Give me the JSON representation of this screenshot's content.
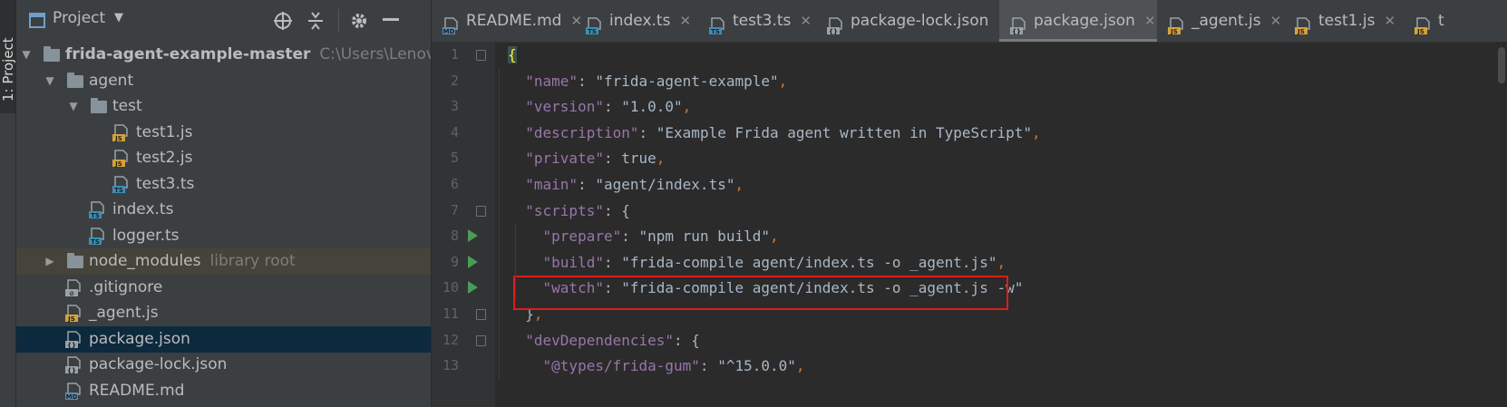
{
  "toolstrip": {
    "project_tab_label": "1: Project"
  },
  "project_panel": {
    "title": "Project",
    "tree": [
      {
        "label": "frida-agent-example-master",
        "hint": "C:\\Users\\Lenovo",
        "type": "folder",
        "expanded": true,
        "bold": true
      },
      {
        "label": "agent",
        "hint": "",
        "type": "folder",
        "expanded": true
      },
      {
        "label": "test",
        "hint": "",
        "type": "folder",
        "expanded": true
      },
      {
        "label": "test1.js",
        "hint": "",
        "type": "js"
      },
      {
        "label": "test2.js",
        "hint": "",
        "type": "js"
      },
      {
        "label": "test3.ts",
        "hint": "",
        "type": "ts"
      },
      {
        "label": "index.ts",
        "hint": "",
        "type": "ts"
      },
      {
        "label": "logger.ts",
        "hint": "",
        "type": "ts"
      },
      {
        "label": "node_modules",
        "hint": "library root",
        "type": "folder",
        "expanded": false
      },
      {
        "label": ".gitignore",
        "hint": "",
        "type": "gitignore"
      },
      {
        "label": "_agent.js",
        "hint": "",
        "type": "js"
      },
      {
        "label": "package.json",
        "hint": "",
        "type": "json",
        "selected": true
      },
      {
        "label": "package-lock.json",
        "hint": "",
        "type": "json"
      },
      {
        "label": "README.md",
        "hint": "",
        "type": "md"
      }
    ]
  },
  "editor_tabs": [
    {
      "label": "README.md",
      "type": "md"
    },
    {
      "label": "index.ts",
      "type": "ts"
    },
    {
      "label": "test3.ts",
      "type": "ts"
    },
    {
      "label": "package-lock.json",
      "type": "json"
    },
    {
      "label": "package.json",
      "type": "json",
      "active": true
    },
    {
      "label": "_agent.js",
      "type": "js"
    },
    {
      "label": "test1.js",
      "type": "js"
    },
    {
      "label": "t",
      "type": "js"
    }
  ],
  "close_glyph": "✕",
  "code": {
    "line_numbers": [
      "1",
      "2",
      "3",
      "4",
      "5",
      "6",
      "7",
      "8",
      "9",
      "10",
      "11",
      "12",
      "13"
    ],
    "lines": [
      "{",
      "  \"name\": \"frida-agent-example\",",
      "  \"version\": \"1.0.0\",",
      "  \"description\": \"Example Frida agent written in TypeScript\",",
      "  \"private\": true,",
      "  \"main\": \"agent/index.ts\",",
      "  \"scripts\": {",
      "    \"prepare\": \"npm run build\",",
      "    \"build\": \"frida-compile agent/index.ts -o _agent.js\",",
      "    \"watch\": \"frida-compile agent/index.ts -o _agent.js -w\"",
      "  },",
      "  \"devDependencies\": {",
      "    \"@types/frida-gum\": \"^15.0.0\","
    ],
    "highlighted_line": 10
  },
  "colors": {
    "key": "#9876aa",
    "string": "#6a8759",
    "keyword": "#cc7832",
    "punct": "#a9b7c6",
    "highlight_box": "#e11b1b",
    "selection": "#0d293e"
  }
}
